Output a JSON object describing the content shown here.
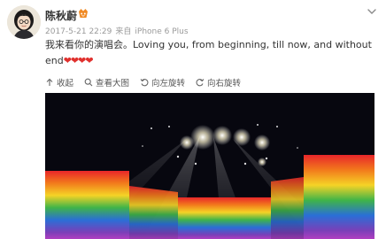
{
  "user": {
    "name": "陈秋蔚",
    "avatar_icon": "avatar-photo",
    "badge_icon": "member-badge-icon"
  },
  "meta": {
    "timestamp": "2017-5-21 22:29",
    "source_prefix": "来自",
    "device": "iPhone 6 Plus"
  },
  "post": {
    "text": "我来看你的演唱会。Loving you, from beginning, till now, and without end",
    "hearts": "❤❤❤❤"
  },
  "actions": {
    "collapse": "收起",
    "view_large": "查看大图",
    "rotate_left": "向左旋转",
    "rotate_right": "向右旋转"
  },
  "photo": {
    "subject": "concert stage with rainbow screens and spotlights"
  },
  "colors": {
    "text": "#333333",
    "meta": "#9a9a9a",
    "heart": "#e0302d",
    "badge": "#f08a24"
  }
}
